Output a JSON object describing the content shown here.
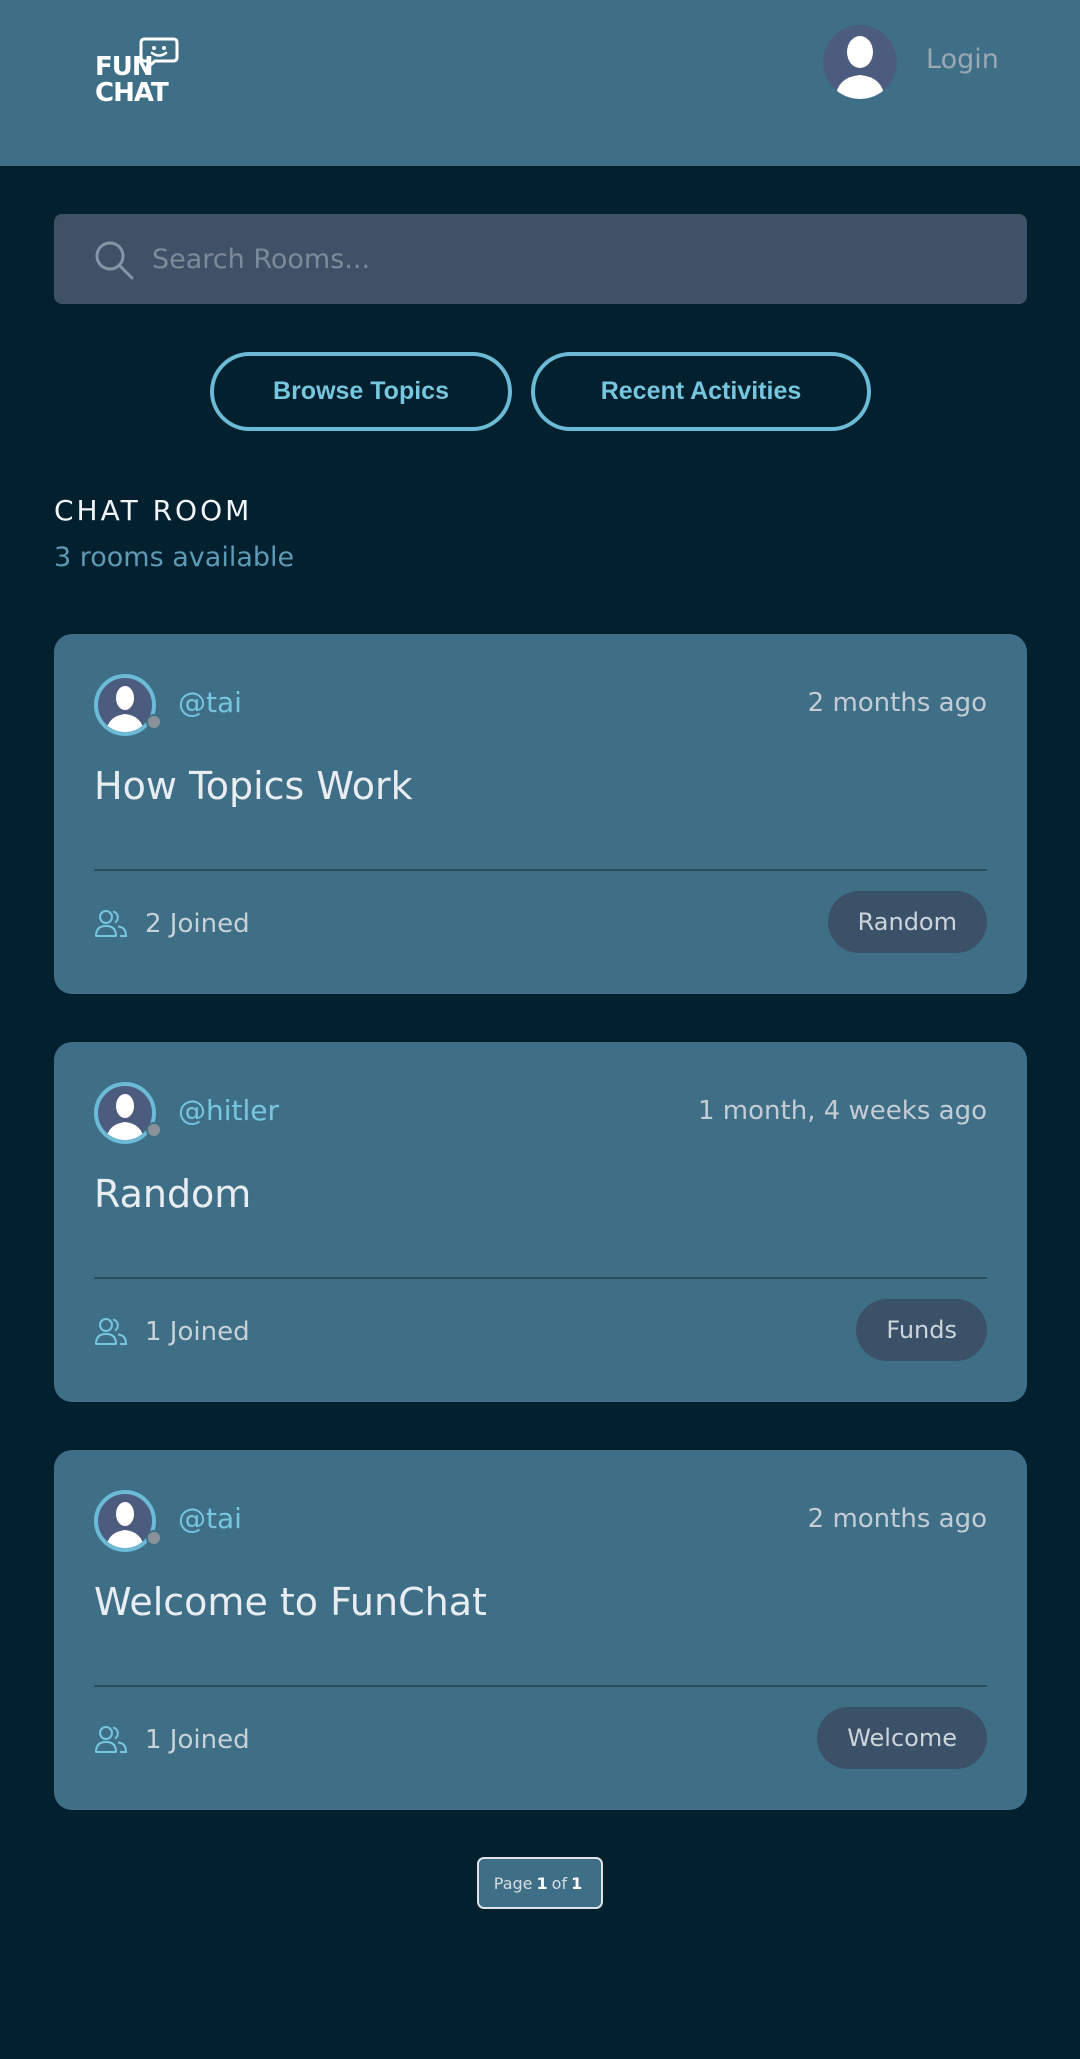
{
  "header": {
    "logo_line1": "FUN",
    "logo_line2": "CHAT",
    "login_label": "Login"
  },
  "search": {
    "placeholder": "Search Rooms..."
  },
  "actions": {
    "browse_label": "Browse Topics",
    "recent_label": "Recent Activities"
  },
  "section": {
    "title": "CHAT ROOM",
    "subtitle": "3 rooms available"
  },
  "rooms": [
    {
      "user": "@tai",
      "time": "2 months ago",
      "title": "How Topics Work",
      "joined": "2 Joined",
      "topic": "Random"
    },
    {
      "user": "@hitler",
      "time": "1 month, 4 weeks ago",
      "title": "Random",
      "joined": "1 Joined",
      "topic": "Funds"
    },
    {
      "user": "@tai",
      "time": "2 months ago",
      "title": "Welcome to FunChat",
      "joined": "1 Joined",
      "topic": "Welcome"
    }
  ],
  "pagination": {
    "prefix": "Page",
    "current": "1",
    "separator": "of",
    "total": "1"
  },
  "colors": {
    "header_bg": "#3f6f87",
    "page_bg": "#02202d",
    "accent": "#76c6e0",
    "card_bg": "#3f6f87",
    "tag_bg": "#3b5168"
  },
  "icons": [
    "funchat-logo-icon",
    "user-avatar-icon",
    "search-icon",
    "people-icon",
    "status-dot-icon"
  ]
}
